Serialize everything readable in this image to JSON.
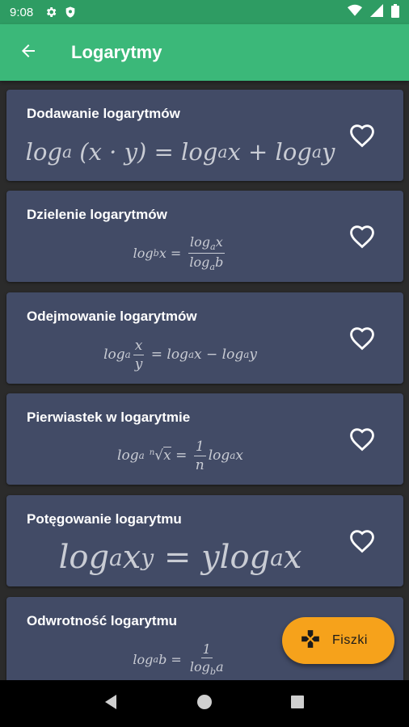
{
  "status": {
    "time": "9:08"
  },
  "appbar": {
    "title": "Logarytmy"
  },
  "cards": [
    {
      "title": "Dodawanie logarytmów",
      "formula": {
        "a": "log",
        "a_sub": "a",
        "b": " (x · y) = log",
        "b_sub": "a",
        "c": "x + log",
        "c_sub": "a",
        "d": "y"
      }
    },
    {
      "title": "Dzielenie logarytmów",
      "formula": {
        "lhs": "log",
        "lhs_sub": "b",
        "lhs_var": "x",
        "eq": " = ",
        "num": "log",
        "num_sub": "a",
        "num_var": "x",
        "den": "log",
        "den_sub": "a",
        "den_var": "b"
      }
    },
    {
      "title": "Odejmowanie logarytmów",
      "formula": {
        "lhs": "log",
        "lhs_sub": "a",
        "num": "x",
        "den": "y",
        "rhs1": " = log",
        "rhs1_sub": "a",
        "rhs2": "x − log",
        "rhs2_sub": "a",
        "rhs3": "y"
      }
    },
    {
      "title": "Pierwiastek w logarytmie",
      "formula": {
        "lhs": "log",
        "lhs_sub": "a",
        "root_index": "n",
        "root_sym": "√",
        "root_var": "x",
        "eq": " = ",
        "num": "1",
        "den": "n",
        "rhs": "log",
        "rhs_sub": "a",
        "rhs_var": "x"
      }
    },
    {
      "title": "Potęgowanie logarytmu",
      "formula": {
        "a": "log",
        "a_sub": "a",
        "b": "x",
        "b_sup": "y",
        "c": " = ylog",
        "c_sub": "a",
        "d": "x"
      }
    },
    {
      "title": "Odwrotność logarytmu",
      "formula": {
        "lhs": "log",
        "lhs_sub": "a",
        "lhs_var": "b",
        "eq": " = ",
        "num": "1",
        "den": "log",
        "den_sub": "b",
        "den_var": "a"
      }
    }
  ],
  "fab": {
    "label": "Fiszki"
  },
  "icons": {
    "status": [
      "gear-icon",
      "shield-icon",
      "wifi-icon",
      "signal-icon",
      "battery-icon"
    ],
    "appbar": [
      "back-arrow-icon"
    ],
    "cards": "heart-outline-icon",
    "fab": "gamepad-icon",
    "nav": [
      "nav-back-icon",
      "nav-home-icon",
      "nav-recents-icon"
    ]
  },
  "colors": {
    "statusbar": "#2e9c63",
    "appbar": "#3bb879",
    "card": "#424b66",
    "background": "#2b2b2b",
    "fab": "#f6a21b"
  }
}
